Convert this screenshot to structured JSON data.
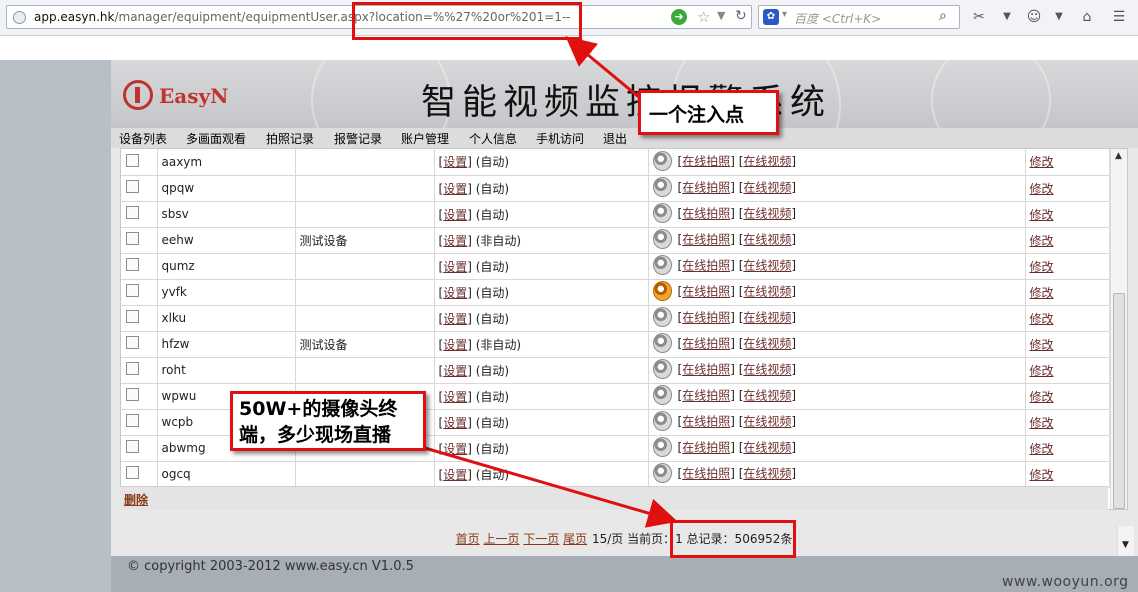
{
  "browser": {
    "url_host": "app.easyn.hk",
    "url_path": "/manager/equipment/equipmentUser.aspx?location=%%27%20or%201=1--",
    "search_placeholder": "百度 <Ctrl+K>"
  },
  "app": {
    "logo_text": "EasyN",
    "title": "智能视频监控报警系统",
    "nav": [
      "设备列表",
      "多画面观看",
      "拍照记录",
      "报警记录",
      "账户管理",
      "个人信息",
      "手机访问",
      "退出"
    ]
  },
  "table": {
    "rows": [
      {
        "name": "aaxym",
        "note": "",
        "status": "(自动)",
        "online": false
      },
      {
        "name": "qpqw",
        "note": "",
        "status": "(自动)",
        "online": false
      },
      {
        "name": "sbsv",
        "note": "",
        "status": "(自动)",
        "online": false
      },
      {
        "name": "eehw",
        "note": "测试设备",
        "status": "(非自动)",
        "online": false
      },
      {
        "name": "qumz",
        "note": "",
        "status": "(自动)",
        "online": false
      },
      {
        "name": "yvfk",
        "note": "",
        "status": "(自动)",
        "online": true
      },
      {
        "name": "xlku",
        "note": "",
        "status": "(自动)",
        "online": false
      },
      {
        "name": "hfzw",
        "note": "测试设备",
        "status": "(非自动)",
        "online": false
      },
      {
        "name": "roht",
        "note": "",
        "status": "(自动)",
        "online": false
      },
      {
        "name": "wpwu",
        "note": "",
        "status": "(自动)",
        "online": false
      },
      {
        "name": "wcpb",
        "note": "",
        "status": "(自动)",
        "online": false
      },
      {
        "name": "abwmg",
        "note": "",
        "status": "(自动)",
        "online": false
      },
      {
        "name": "ogcq",
        "note": "",
        "status": "(自动)",
        "online": false
      }
    ],
    "setting_label": "设置",
    "photo_label": "在线拍照",
    "video_label": "在线视频",
    "modify_label": "修改",
    "delete_label": "删除"
  },
  "pager": {
    "first": "首页",
    "prev": "上一页",
    "next": "下一页",
    "last": "尾页",
    "info": "15/页 当前页：1 总记录：506952条"
  },
  "footer": {
    "copyright": "© copyright 2003-2012 www.easy.cn V1.0.5"
  },
  "annotations": {
    "injection_note": "一个注入点",
    "cameras_note_line1": "50W+的摄像头终",
    "cameras_note_line2": "端，多少现场直播",
    "watermark": "www.wooyun.org"
  }
}
